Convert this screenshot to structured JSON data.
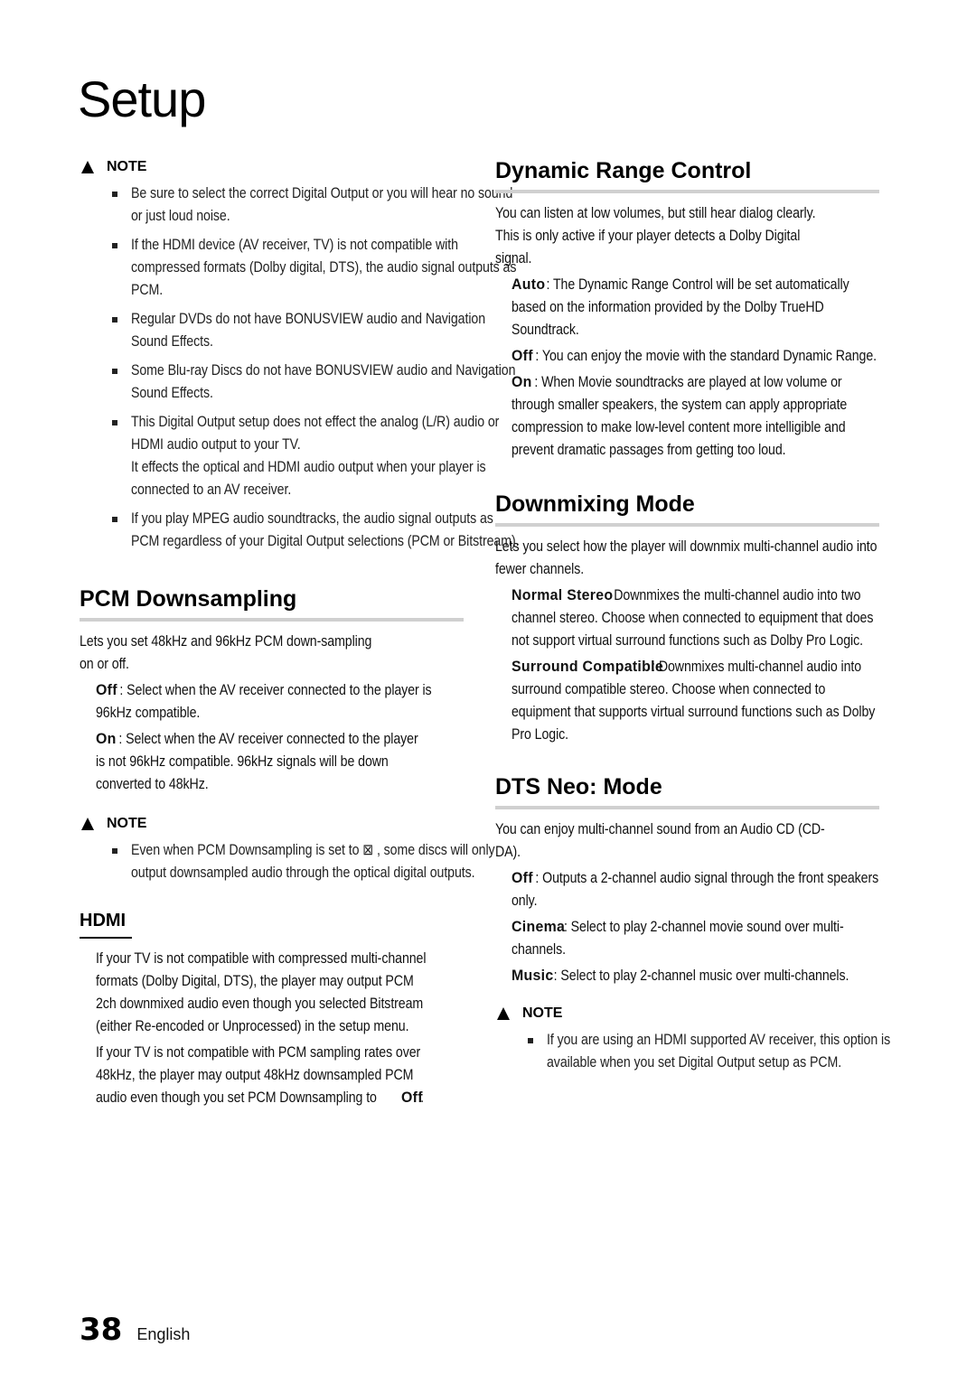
{
  "page": {
    "title": "Setup",
    "page_number": "38",
    "language": "English"
  },
  "left": {
    "note1": {
      "label": "NOTE",
      "items": [
        "Be sure to select the correct Digital Output or you will hear no sound or just loud noise.",
        "If the HDMI device (AV receiver, TV) is not compatible with compressed formats (Dolby digital, DTS), the audio signal outputs as PCM.",
        "Regular DVDs do not have BONUSVIEW audio and Navigation Sound Effects.",
        "Some Blu-ray Discs do not have BONUSVIEW audio and Navigation Sound Effects.",
        "This Digital Output setup does not effect the analog (L/R) audio or HDMI audio output to your TV.",
        "If you play MPEG audio soundtracks, the audio signal outputs as PCM regardless of your Digital Output selections (PCM or Bitstream)."
      ],
      "item5_extra": "It effects the optical and HDMI audio output when your player is connected to an AV receiver."
    },
    "pcm": {
      "heading": "PCM Downsampling",
      "intro": "Lets you set 48kHz and 96kHz PCM down-sampling on or off.",
      "options": [
        {
          "label": "Off",
          "text": ": Select when the AV receiver connected to the player is 96kHz compatible."
        },
        {
          "label": "On",
          "text": ": Select when the AV receiver connected to the player is not 96kHz compatible. 96kHz signals will be down converted to 48kHz."
        }
      ]
    },
    "note2": {
      "label": "NOTE",
      "items": [
        "Even when PCM Downsampling is set to ⊠ , some discs will only output downsampled audio through the optical digital outputs."
      ]
    },
    "hdmi": {
      "heading": "HDMI",
      "para1": "If your TV is not compatible with compressed multi-channel formats (Dolby Digital, DTS), the player may output PCM 2ch downmixed audio even though you selected Bitstream (either Re-encoded or Unprocessed) in the setup menu.",
      "para2_prefix": "If your TV is not compatible with PCM sampling rates over 48kHz, the player may output 48kHz downsampled PCM audio even though you set PCM Downsampling to",
      "para2_value": "Off",
      "para2_suffix": "."
    }
  },
  "right": {
    "drc": {
      "heading": "Dynamic Range Control",
      "intro1": "You can listen at low volumes, but still hear dialog clearly.",
      "intro2": "This is only active if your player detects a Dolby Digital signal.",
      "options": [
        {
          "label": "Auto",
          "text": ": The Dynamic Range Control will be set automatically based on the information provided by the Dolby TrueHD Soundtrack."
        },
        {
          "label": "Off",
          "text": ": You can enjoy the movie with the standard Dynamic Range."
        },
        {
          "label": "On",
          "text": ": When Movie soundtracks are played at low volume or through smaller speakers, the system can apply appropriate compression to make low-level content more intelligible and prevent dramatic passages from getting too loud."
        }
      ]
    },
    "downmix": {
      "heading": "Downmixing Mode",
      "intro": "Lets you select how the player will downmix multi-channel audio into fewer channels.",
      "options": [
        {
          "label": "Normal Stereo",
          "text": ": Downmixes the multi-channel audio into two channel stereo. Choose when connected to equipment that does not support virtual surround functions such as Dolby Pro Logic."
        },
        {
          "label": "Surround Compatible",
          "text": ": Downmixes multi-channel audio into surround compatible stereo. Choose when connected to equipment that supports virtual surround functions such as Dolby Pro Logic."
        }
      ]
    },
    "dts": {
      "heading": "DTS Neo: Mode",
      "intro": "You can enjoy multi-channel sound from an Audio CD (CD-DA).",
      "options": [
        {
          "label": "Off",
          "text": ": Outputs a 2-channel audio signal through the front speakers only."
        },
        {
          "label": "Cinema",
          "text": ": Select to play 2-channel movie sound over multi-channels."
        },
        {
          "label": "Music",
          "text": ": Select to play 2-channel music over multi-channels."
        }
      ]
    },
    "note3": {
      "label": "NOTE",
      "items": [
        "If you are using an HDMI supported AV receiver, this option is available when you set Digital Output setup as PCM."
      ]
    }
  }
}
